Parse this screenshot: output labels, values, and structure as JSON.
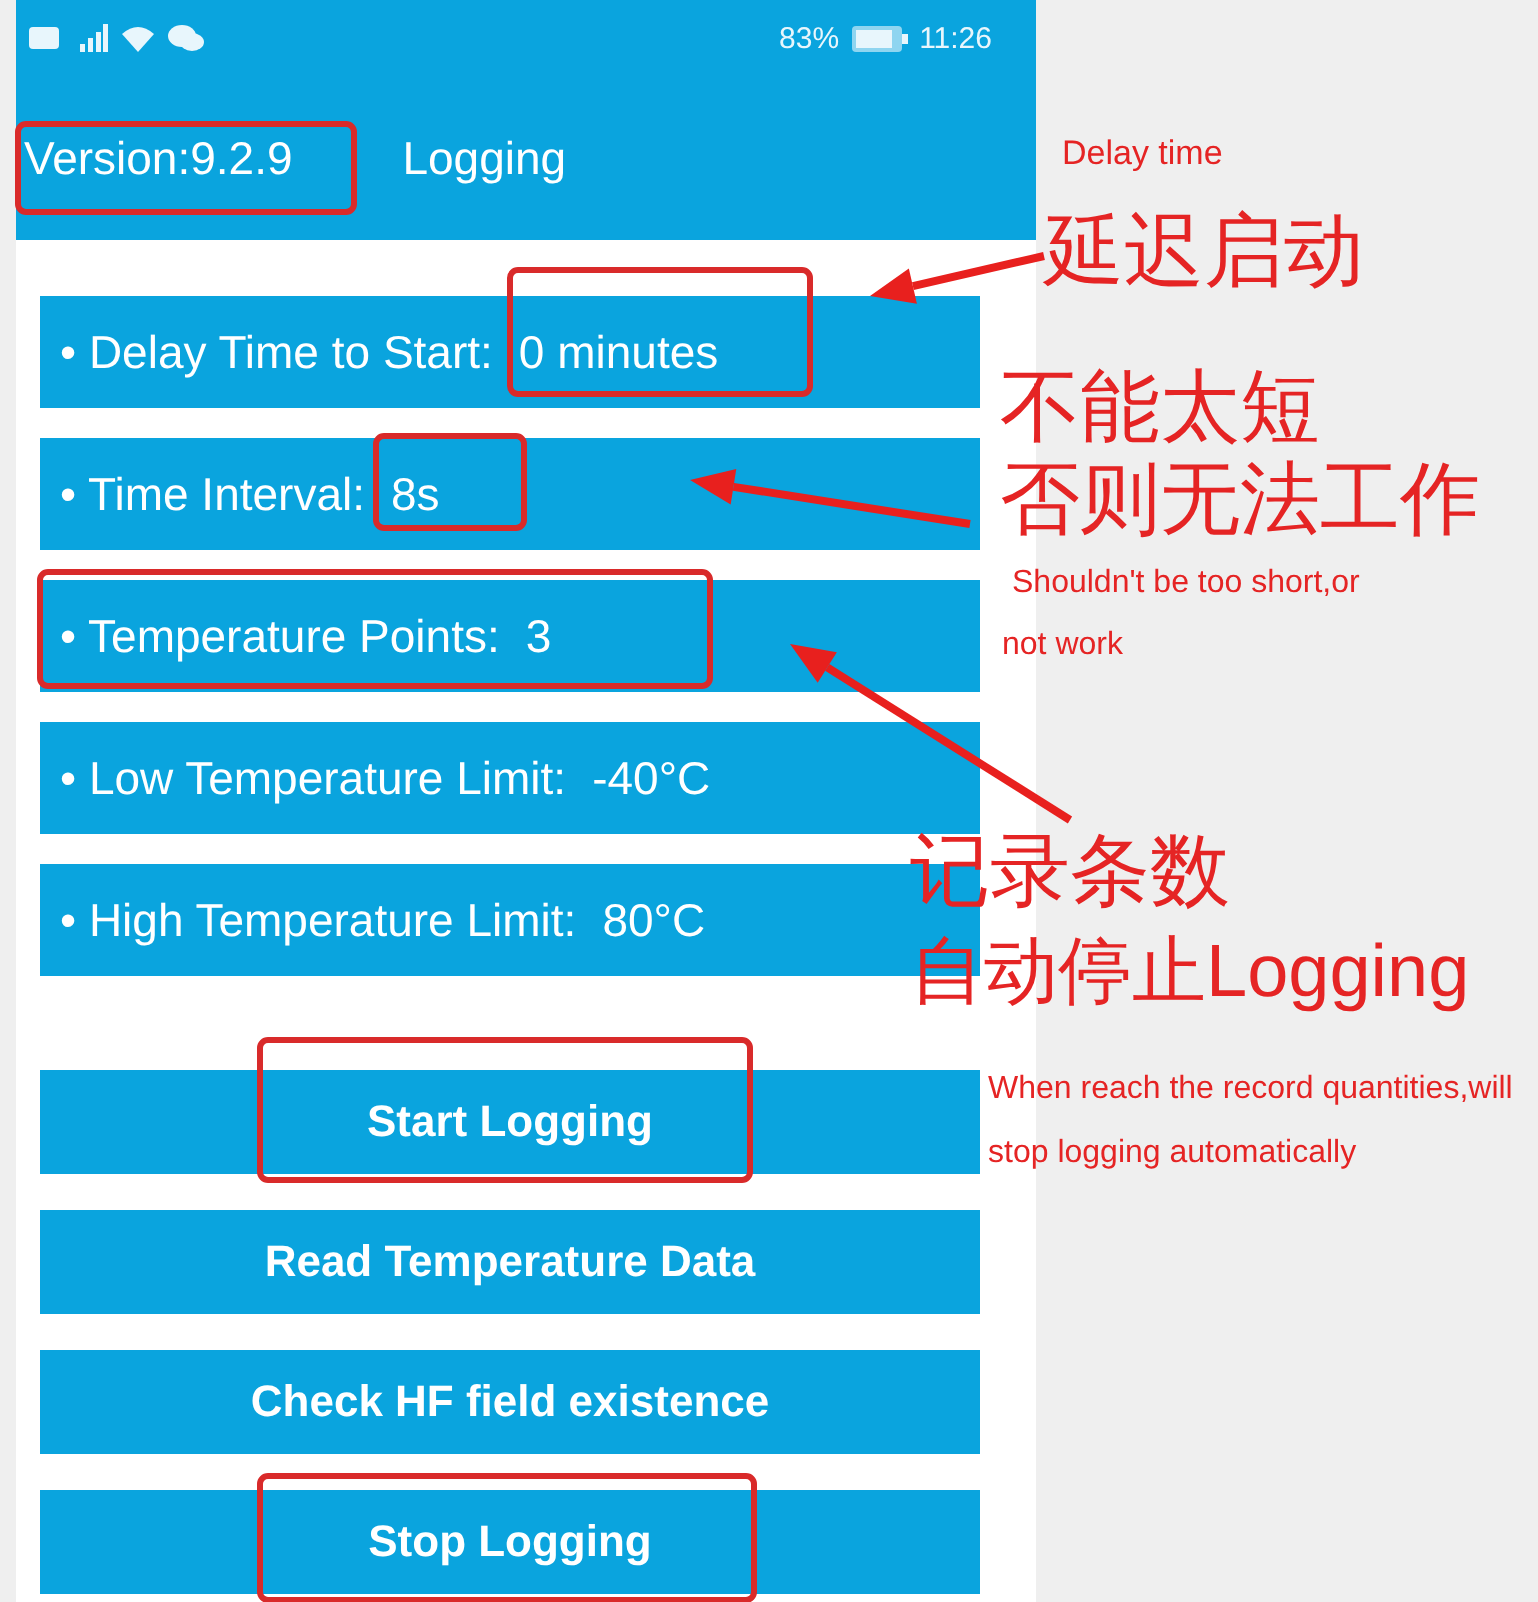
{
  "status_bar": {
    "battery": "83%",
    "time": "11:26"
  },
  "app_bar": {
    "version": "Version:9.2.9",
    "title": "Logging"
  },
  "settings": [
    {
      "label": "• Delay Time to Start:",
      "value": "0 minutes"
    },
    {
      "label": "• Time Interval:",
      "value": "8s"
    },
    {
      "label": "• Temperature Points:",
      "value": "3"
    },
    {
      "label": "• Low Temperature Limit:",
      "value": "-40°C"
    },
    {
      "label": "• High Temperature Limit:",
      "value": "80°C"
    }
  ],
  "buttons": [
    "Start Logging",
    "Read Temperature Data",
    "Check HF field existence",
    "Stop Logging"
  ],
  "annotations": [
    {
      "text": "Delay time"
    },
    {
      "text": "延迟启动"
    },
    {
      "text": "不能太短"
    },
    {
      "text": "否则无法工作"
    },
    {
      "text": "Shouldn't be too short,or"
    },
    {
      "text": "not work"
    },
    {
      "text": "记录条数"
    },
    {
      "text": "自动停止Logging"
    },
    {
      "text": "When reach the record quantities,will"
    },
    {
      "text": "stop logging automatically"
    }
  ]
}
